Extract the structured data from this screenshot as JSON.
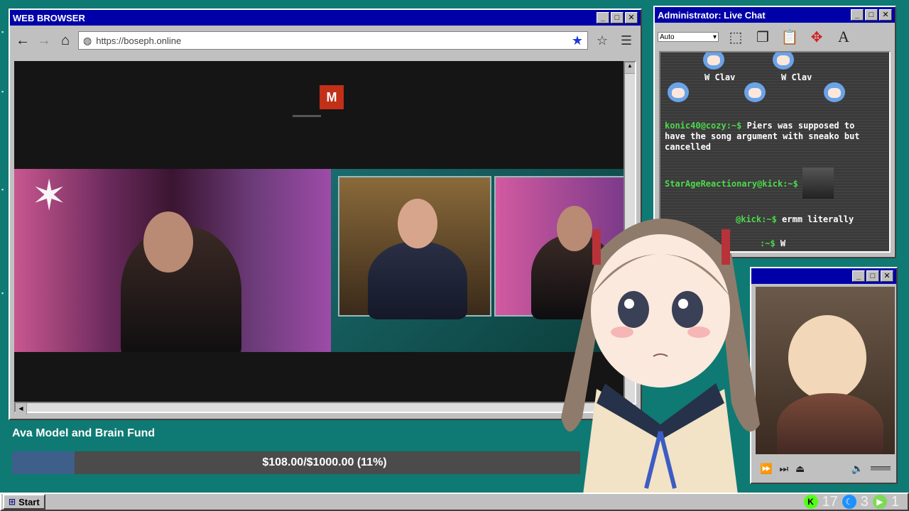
{
  "browser": {
    "title": "WEB BROWSER",
    "url": "https://boseph.online",
    "video": {
      "badge": "M"
    }
  },
  "fund": {
    "title": "Ava Model and Brain Fund",
    "progress_text": "$108.00/$1000.00 (11%)",
    "progress_fraction": 0.11
  },
  "chat": {
    "title": "Administrator: Live Chat",
    "select_value": "Auto",
    "emote_labels": [
      "W Clav",
      "W Clav"
    ],
    "messages": [
      {
        "user": "konic40@cozy:~$",
        "text": "Piers was supposed to have the song argument with sneako but cancelled"
      },
      {
        "user": "StarAgeReactionary@kick:~$",
        "text": ""
      },
      {
        "user": "@kick:~$",
        "text": "ermm literally"
      },
      {
        "user": ":~$",
        "text": "W"
      }
    ]
  },
  "taskbar": {
    "start_label": "Start",
    "tray": [
      {
        "icon": "kick-icon",
        "count": "17",
        "color": "#53fc18"
      },
      {
        "icon": "moon-icon",
        "count": "3",
        "color": "#1e90ff"
      },
      {
        "icon": "play-icon",
        "count": "1",
        "color": "#7ed957"
      }
    ]
  },
  "colors": {
    "desktop": "#0e7a73",
    "titlebar": "#0000a8",
    "chat_user": "#4cd94c",
    "fund_fill": "#3e5f8a"
  }
}
